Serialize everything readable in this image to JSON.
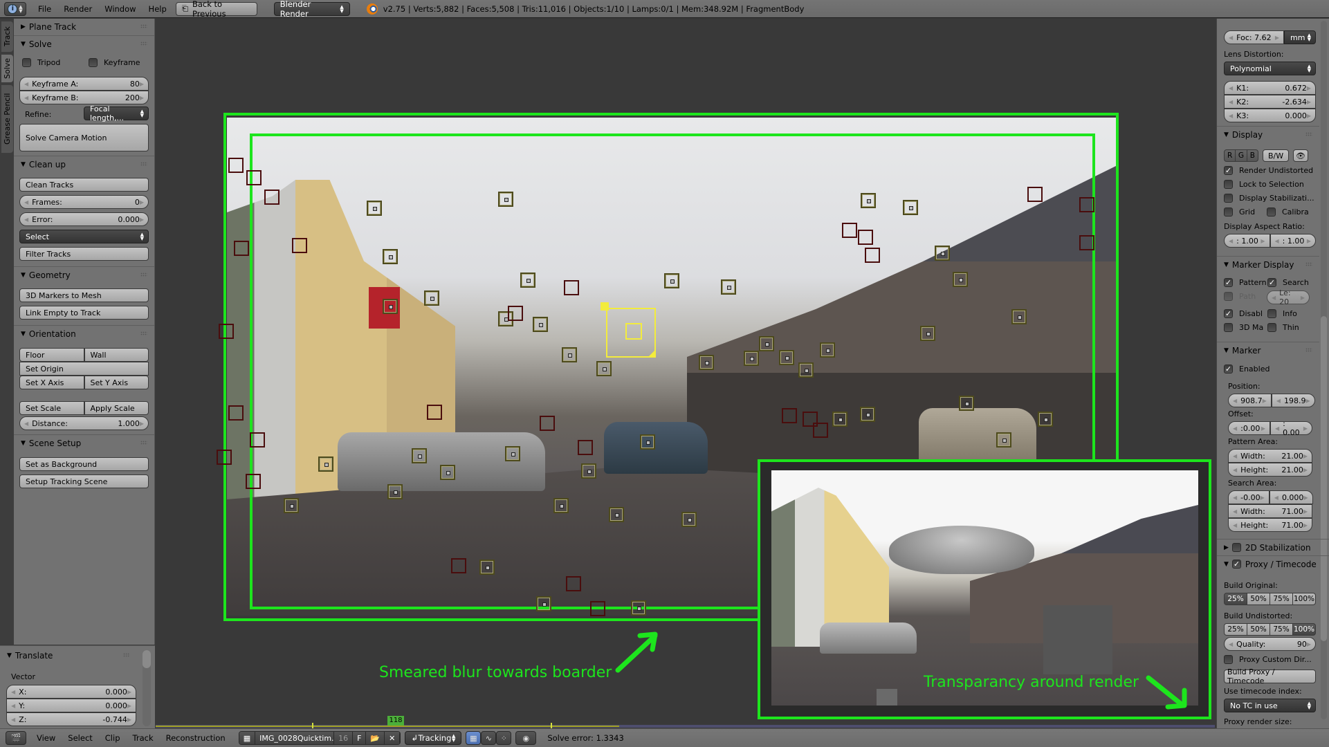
{
  "topbar": {
    "editor_type_icon": "info-icon",
    "menus": [
      "File",
      "Render",
      "Window",
      "Help"
    ],
    "back_button": "Back to Previous",
    "render_engine": "Blender Render",
    "stats": "v2.75 | Verts:5,882 | Faces:5,508 | Tris:11,016 | Objects:1/10 | Lamps:0/1 | Mem:348.92M | FragmentBody"
  },
  "tool_tabs": [
    "Track",
    "Solve",
    "Grease Pencil"
  ],
  "active_tool_tab": "Solve",
  "left_panel": {
    "plane_track": {
      "title": "Plane Track",
      "expanded": false
    },
    "solve": {
      "title": "Solve",
      "tripod": {
        "label": "Tripod",
        "checked": false
      },
      "keyframe": {
        "label": "Keyframe",
        "checked": false
      },
      "keyframe_a": {
        "label": "Keyframe A:",
        "value": "80"
      },
      "keyframe_b": {
        "label": "Keyframe B:",
        "value": "200"
      },
      "refine_label": "Refine:",
      "refine_value": "Focal length,...",
      "solve_button": "Solve Camera Motion"
    },
    "cleanup": {
      "title": "Clean up",
      "clean_tracks": "Clean Tracks",
      "frames": {
        "label": "Frames:",
        "value": "0"
      },
      "error": {
        "label": "Error:",
        "value": "0.000"
      },
      "select": "Select",
      "filter_tracks": "Filter Tracks"
    },
    "geometry": {
      "title": "Geometry",
      "markers_to_mesh": "3D Markers to Mesh",
      "link_empty": "Link Empty to Track"
    },
    "orientation": {
      "title": "Orientation",
      "floor": "Floor",
      "wall": "Wall",
      "set_origin": "Set Origin",
      "set_x": "Set X Axis",
      "set_y": "Set Y Axis",
      "set_scale": "Set Scale",
      "apply_scale": "Apply Scale",
      "distance": {
        "label": "Distance:",
        "value": "1.000"
      }
    },
    "scene_setup": {
      "title": "Scene Setup",
      "set_background": "Set as Background",
      "setup_tracking": "Setup Tracking Scene"
    }
  },
  "operator_panel": {
    "title": "Translate",
    "vector_label": "Vector",
    "x": {
      "label": "X:",
      "value": "0.000"
    },
    "y": {
      "label": "Y:",
      "value": "0.000"
    },
    "z": {
      "label": "Z:",
      "value": "-0.744"
    }
  },
  "viewport": {
    "annotation_left": "Smeared blur towards boarder",
    "annotation_right": "Transparancy around render",
    "annotation_color": "#1de51d",
    "marker_color": "#4d4a1c",
    "disabled_marker_color": "#4a0d0d",
    "selected_marker_color": "#f3ec3c"
  },
  "timeline": {
    "current_frame": "118"
  },
  "bottombar": {
    "editor_icon": "movie-clip-icon",
    "menus": [
      "View",
      "Select",
      "Clip",
      "Track",
      "Reconstruction"
    ],
    "clip_name": "IMG_0028Quicktim...",
    "clip_users": "16",
    "fake_user": "F",
    "mode": "Tracking",
    "solve_error": "Solve error: 1.3343"
  },
  "right_panel": {
    "focal": {
      "label": "Foc: 7.62",
      "unit": "mm"
    },
    "lens_distortion_label": "Lens Distortion:",
    "lens_distortion_value": "Polynomial",
    "k1": {
      "label": "K1:",
      "value": "0.672"
    },
    "k2": {
      "label": "K2:",
      "value": "-2.634"
    },
    "k3": {
      "label": "K3:",
      "value": "0.000"
    },
    "display": {
      "title": "Display",
      "channels": [
        "R",
        "G",
        "B"
      ],
      "bw": "B/W",
      "render_undistorted": {
        "label": "Render Undistorted",
        "checked": true
      },
      "lock_selection": {
        "label": "Lock to Selection",
        "checked": false
      },
      "display_stabilization": {
        "label": "Display Stabilizati...",
        "checked": false
      },
      "grid": {
        "label": "Grid",
        "checked": false
      },
      "calibra": {
        "label": "Calibra",
        "checked": false
      },
      "aspect_label": "Display Aspect Ratio:",
      "aspect_x": ": 1.00",
      "aspect_y": ": 1.00"
    },
    "marker_display": {
      "title": "Marker Display",
      "pattern": {
        "label": "Pattern",
        "checked": true
      },
      "search": {
        "label": "Search",
        "checked": true
      },
      "path": {
        "label": "Path",
        "checked": false
      },
      "length": "Le: 20",
      "disabled": {
        "label": "Disabl",
        "checked": true
      },
      "info": {
        "label": "Info",
        "checked": false
      },
      "markers_3d": {
        "label": "3D Ma",
        "checked": false
      },
      "thin": {
        "label": "Thin",
        "checked": false
      }
    },
    "marker": {
      "title": "Marker",
      "enabled": {
        "label": "Enabled",
        "checked": true
      },
      "position_label": "Position:",
      "position_x": "908.7",
      "position_y": "198.9",
      "offset_label": "Offset:",
      "offset_x": ":0.00",
      "offset_y": ": 0.00",
      "pattern_area_label": "Pattern Area:",
      "pattern_width": {
        "label": "Width:",
        "value": "21.00"
      },
      "pattern_height": {
        "label": "Height:",
        "value": "21.00"
      },
      "search_area_label": "Search Area:",
      "search_x": "-0.00",
      "search_y": "0.000",
      "search_width": {
        "label": "Width:",
        "value": "71.00"
      },
      "search_height": {
        "label": "Height:",
        "value": "71.00"
      }
    },
    "stabilization": {
      "title": "2D Stabilization",
      "checked": false
    },
    "proxy": {
      "title": "Proxy / Timecode",
      "checked": true,
      "build_original_label": "Build Original:",
      "build_original": [
        "25%",
        "50%",
        "75%",
        "100%"
      ],
      "build_original_active": "25%",
      "build_undistorted_label": "Build Undistorted:",
      "build_undistorted": [
        "25%",
        "50%",
        "75%",
        "100%"
      ],
      "build_undistorted_active": "100%",
      "quality": {
        "label": "Quality:",
        "value": "90"
      },
      "custom_dir": {
        "label": "Proxy Custom Dir...",
        "checked": false
      },
      "build_button": "Build Proxy / Timecode",
      "timecode_label": "Use timecode index:",
      "timecode_value": "No TC in use",
      "render_size_label": "Proxy render size:"
    }
  }
}
